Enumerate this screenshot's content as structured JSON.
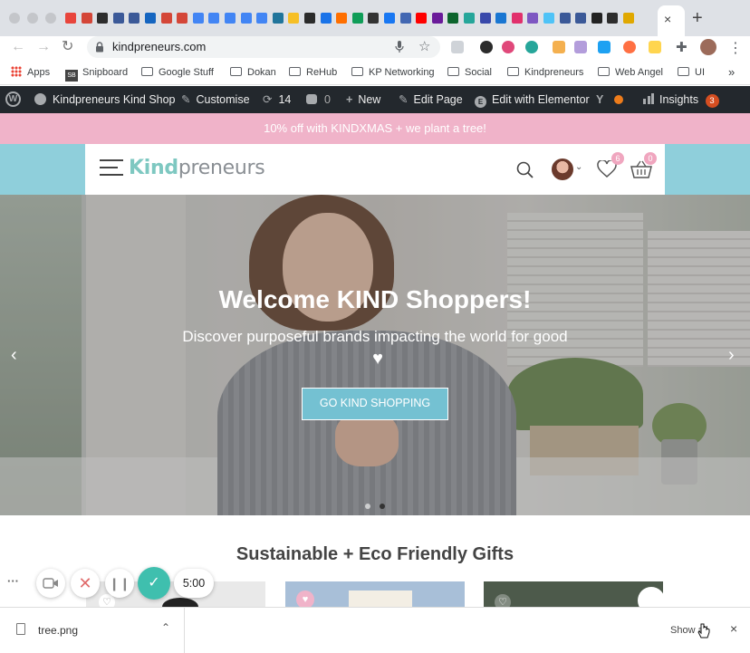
{
  "browser": {
    "url": "kindpreneurs.com",
    "tab_close": "×",
    "new_tab": "+",
    "nav": {
      "back": "←",
      "forward": "→",
      "reload": "↻"
    },
    "more_bookmarks": "»"
  },
  "bookmarks": [
    {
      "label": "Apps",
      "icon": "apps-grid-icon"
    },
    {
      "label": "Snipboard",
      "icon": "snipboard-icon"
    },
    {
      "label": "Google Stuff",
      "icon": "folder-icon"
    },
    {
      "label": "Dokan",
      "icon": "folder-icon"
    },
    {
      "label": "ReHub",
      "icon": "folder-icon"
    },
    {
      "label": "KP Networking",
      "icon": "folder-icon"
    },
    {
      "label": "Social",
      "icon": "folder-icon"
    },
    {
      "label": "Kindpreneurs",
      "icon": "folder-icon"
    },
    {
      "label": "Web Angel",
      "icon": "folder-icon"
    },
    {
      "label": "UI",
      "icon": "folder-icon"
    }
  ],
  "admin_bar": {
    "site_name": "Kindpreneurs Kind Shop",
    "customise": "Customise",
    "updates": "14",
    "comments": "0",
    "new": "New",
    "edit_page": "Edit Page",
    "elementor": "Edit with Elementor",
    "insights": "Insights",
    "insights_count": "3"
  },
  "promo": "10% off with KINDXMAS + we plant a tree!",
  "header": {
    "logo_kind": "Kind",
    "logo_rest": "preneurs",
    "wishlist_count": "6",
    "cart_count": "0"
  },
  "hero": {
    "title": "Welcome KIND Shoppers!",
    "subtitle": "Discover purposeful brands impacting the world for good",
    "heart": "♥",
    "button": "GO KIND SHOPPING",
    "prev": "‹",
    "next": "›"
  },
  "section_title": "Sustainable + Eco Friendly Gifts",
  "recorder": {
    "more": "···",
    "timer": "5:00"
  },
  "download": {
    "filename": "tree.png",
    "show_all": "Show all",
    "close": "×"
  },
  "colors": {
    "promo_bg": "#f0b3c9",
    "header_band": "#8fcfdb",
    "button": "#74c1d2",
    "adminbar": "#23282d",
    "recorder_accent": "#3fbfae"
  }
}
